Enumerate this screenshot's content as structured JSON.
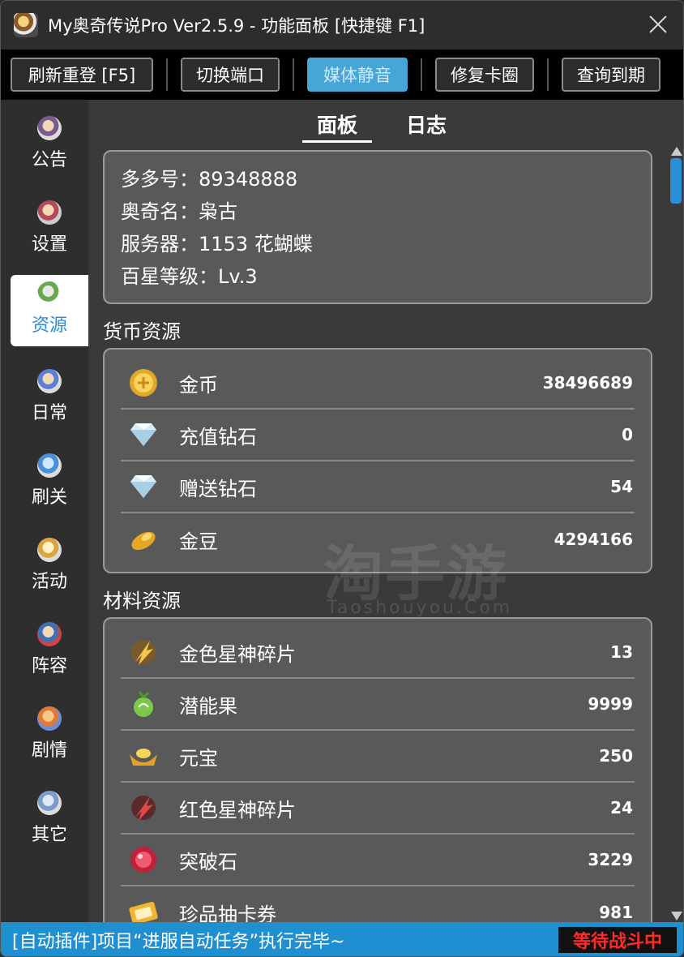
{
  "window": {
    "title": "My奥奇传说Pro  Ver2.5.9 - 功能面板 [快捷键 F1]"
  },
  "toolbar": {
    "buttons": [
      {
        "label": "刷新重登 [F5]"
      },
      {
        "label": "切换端口"
      },
      {
        "label": "媒体静音"
      },
      {
        "label": "修复卡圈"
      },
      {
        "label": "查询到期"
      }
    ],
    "active_button": "媒体静音"
  },
  "sidebar": {
    "items": [
      {
        "label": "公告",
        "icon": "character-icon"
      },
      {
        "label": "设置",
        "icon": "character-icon"
      },
      {
        "label": "资源",
        "icon": "character-icon"
      },
      {
        "label": "日常",
        "icon": "character-icon"
      },
      {
        "label": "刷关",
        "icon": "character-icon"
      },
      {
        "label": "活动",
        "icon": "character-icon"
      },
      {
        "label": "阵容",
        "icon": "character-icon"
      },
      {
        "label": "剧情",
        "icon": "character-icon"
      },
      {
        "label": "其它",
        "icon": "character-icon"
      }
    ],
    "active_item": "资源"
  },
  "tabs": [
    {
      "label": "面板"
    },
    {
      "label": "日志"
    }
  ],
  "active_tab": "面板",
  "account": {
    "lines": [
      "多多号：89348888",
      "奥奇名：枭古",
      "服务器：1153 花蝴蝶",
      "百星等级：Lv.3"
    ]
  },
  "currency": {
    "title": "货币资源",
    "items": [
      {
        "name": "金币",
        "value": "38496689",
        "icon": "gold-coin-icon"
      },
      {
        "name": "充值钻石",
        "value": "0",
        "icon": "diamond-icon"
      },
      {
        "name": "赠送钻石",
        "value": "54",
        "icon": "diamond-icon"
      },
      {
        "name": "金豆",
        "value": "4294166",
        "icon": "gold-bean-icon"
      }
    ]
  },
  "materials": {
    "title": "材料资源",
    "items": [
      {
        "name": "金色星神碎片",
        "value": "13",
        "icon": "gold-star-shard-icon"
      },
      {
        "name": "潜能果",
        "value": "9999",
        "icon": "potential-fruit-icon"
      },
      {
        "name": "元宝",
        "value": "250",
        "icon": "gold-ingot-icon"
      },
      {
        "name": "红色星神碎片",
        "value": "24",
        "icon": "red-star-shard-icon"
      },
      {
        "name": "突破石",
        "value": "3229",
        "icon": "breakthrough-stone-icon"
      },
      {
        "name": "珍品抽卡券",
        "value": "981",
        "icon": "card-ticket-icon"
      }
    ]
  },
  "watermark": {
    "text": "淘手游",
    "sub": "Taoshouyou.Com"
  },
  "status": {
    "message": "[自动插件]项目“进服自动任务”执行完毕~",
    "badge": "等待战斗中"
  },
  "colors": {
    "accent": "#2a8fd4",
    "active_button": "#46a6d8",
    "status_bar": "#1f8fd0",
    "badge_text": "#ff2a2a"
  }
}
